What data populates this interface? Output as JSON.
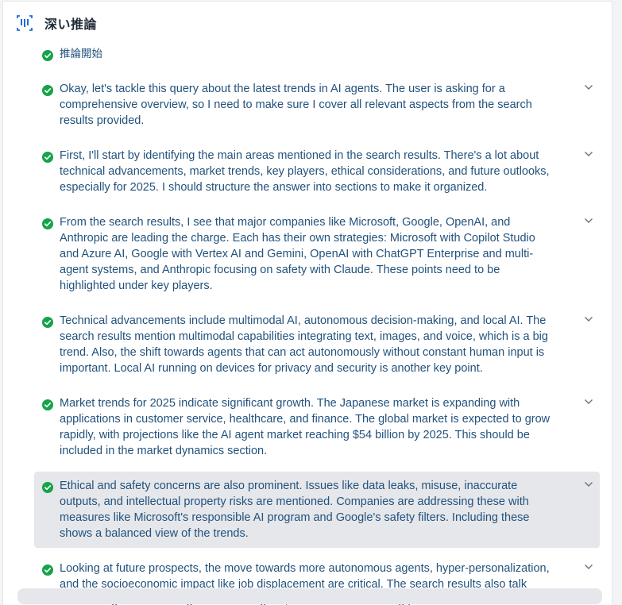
{
  "header": {
    "title": "深い推論",
    "icon": "voice-wave-icon",
    "accent": "#1d6fd6"
  },
  "colors": {
    "check": "#16a34a",
    "text": "#23527c",
    "highlight": "#e5e7eb"
  },
  "steps": [
    {
      "text": "推論開始",
      "icon": "check-circle-icon"
    },
    {
      "text": "Okay, let's tackle this query about the latest trends in AI agents. The user is asking for a comprehensive overview, so I need to make sure I cover all relevant aspects from the search results provided.",
      "icon": "check-circle-icon"
    },
    {
      "text": "First, I'll start by identifying the main areas mentioned in the search results. There's a lot about technical advancements, market trends, key players, ethical considerations, and future outlooks, especially for 2025. I should structure the answer into sections to make it organized.",
      "icon": "check-circle-icon"
    },
    {
      "text": "From the search results, I see that major companies like Microsoft, Google, OpenAI, and Anthropic are leading the charge. Each has their own strategies: Microsoft with Copilot Studio and Azure AI, Google with Vertex AI and Gemini, OpenAI with ChatGPT Enterprise and multi-agent systems, and Anthropic focusing on safety with Claude. These points need to be highlighted under key players.",
      "icon": "check-circle-icon"
    },
    {
      "text": "Technical advancements include multimodal AI, autonomous decision-making, and local AI. The search results mention multimodal capabilities integrating text, images, and voice, which is a big trend. Also, the shift towards agents that can act autonomously without constant human input is important. Local AI running on devices for privacy and security is another key point.",
      "icon": "check-circle-icon"
    },
    {
      "text": "Market trends for 2025 indicate significant growth. The Japanese market is expanding with applications in customer service, healthcare, and finance. The global market is expected to grow rapidly, with projections like the AI agent market reaching $54 billion by 2025. This should be included in the market dynamics section.",
      "icon": "check-circle-icon"
    },
    {
      "text": "Ethical and safety concerns are also prominent. Issues like data leaks, misuse, inaccurate outputs, and intellectual property risks are mentioned. Companies are addressing these with measures like Microsoft's responsible AI program and Google's safety filters. Including these shows a balanced view of the trends.",
      "icon": "check-circle-icon",
      "highlighted": true
    },
    {
      "text": "Looking at future prospects, the move towards more autonomous agents, hyper-personalization, and the socioeconomic impact like job displacement are critical. The search results also talk about AI agents becoming virtual colleagues, which is an interesting point for the future outlook.",
      "icon": "check-circle-icon"
    }
  ]
}
